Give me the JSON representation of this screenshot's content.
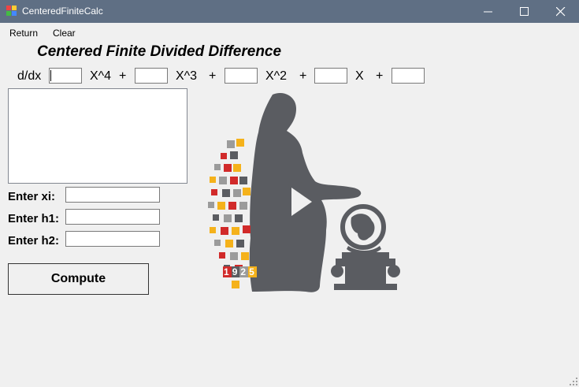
{
  "window": {
    "title": "CenteredFiniteCalc"
  },
  "menu": {
    "return_label": "Return",
    "clear_label": "Clear"
  },
  "heading": "Centered Finite Divided Difference",
  "polynomial": {
    "prefix": "d/dx",
    "terms": [
      "X^4",
      "X^3",
      "X^2",
      "X"
    ],
    "plus": "+",
    "coefficients": [
      "",
      "",
      "",
      "",
      ""
    ]
  },
  "fields": {
    "xi_label": "Enter xi:",
    "xi_value": "",
    "h1_label": "Enter h1:",
    "h1_value": "",
    "h2_label": "Enter h2:",
    "h2_value": ""
  },
  "output_text": "",
  "compute_label": "Compute",
  "logo": {
    "year_digits": [
      "1",
      "9",
      "2",
      "5"
    ],
    "colors": {
      "silhouette": "#5a5c61",
      "red": "#d12a2a",
      "yellow": "#f5b21b",
      "gray": "#9b9b9b"
    }
  },
  "colors": {
    "titlebar": "#5f6f84",
    "window_bg": "#f0f0f0"
  }
}
